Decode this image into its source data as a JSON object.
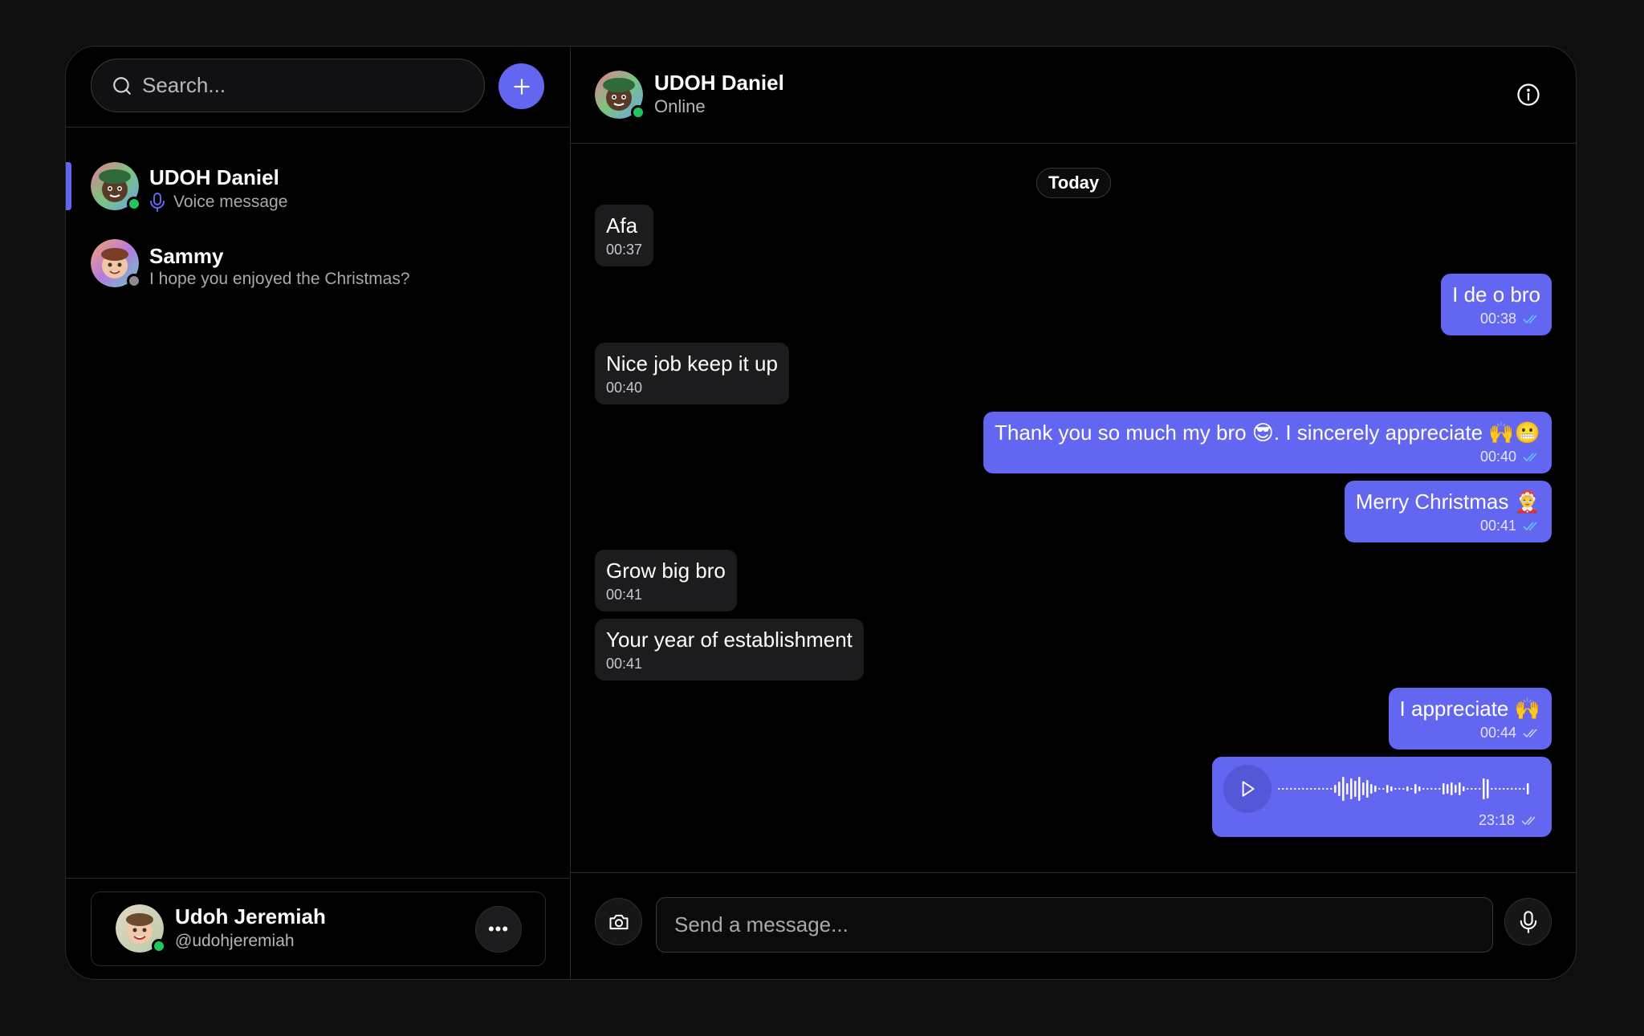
{
  "search": {
    "placeholder": "Search..."
  },
  "sidebar": {
    "chats": [
      {
        "name": "UDOH Daniel",
        "preview": "Voice message",
        "status": "online",
        "active": true
      },
      {
        "name": "Sammy",
        "preview": "I hope you enjoyed the Christmas?",
        "status": "offline",
        "active": false
      }
    ],
    "profile": {
      "name": "Udoh Jeremiah",
      "handle": "@udohjeremiah",
      "more_label": "•••"
    }
  },
  "header": {
    "name": "UDOH Daniel",
    "status": "Online"
  },
  "conversation": {
    "date_divider": "Today",
    "messages": [
      {
        "direction": "in",
        "text": "Afa",
        "time": "00:37"
      },
      {
        "direction": "out",
        "text": "I de o bro",
        "time": "00:38",
        "read": true
      },
      {
        "direction": "in",
        "text": "Nice job keep it up",
        "time": "00:40"
      },
      {
        "direction": "out",
        "text": "Thank you so much my bro 😎. I sincerely appreciate 🙌😬",
        "time": "00:40",
        "read": true
      },
      {
        "direction": "out",
        "text": "Merry Christmas 🤶",
        "time": "00:41",
        "read": true
      },
      {
        "direction": "in",
        "text": "Grow big bro",
        "time": "00:41"
      },
      {
        "direction": "in",
        "text": "Your year of establishment",
        "time": "00:41"
      },
      {
        "direction": "out",
        "text": "I appreciate 🙌",
        "time": "00:44",
        "read": false
      },
      {
        "direction": "out",
        "type": "voice",
        "time": "23:18",
        "read": false
      }
    ]
  },
  "composer": {
    "placeholder": "Send a message..."
  },
  "colors": {
    "accent": "#6366f1",
    "online": "#22c55e",
    "read_ticks": "#5ec7ff"
  }
}
